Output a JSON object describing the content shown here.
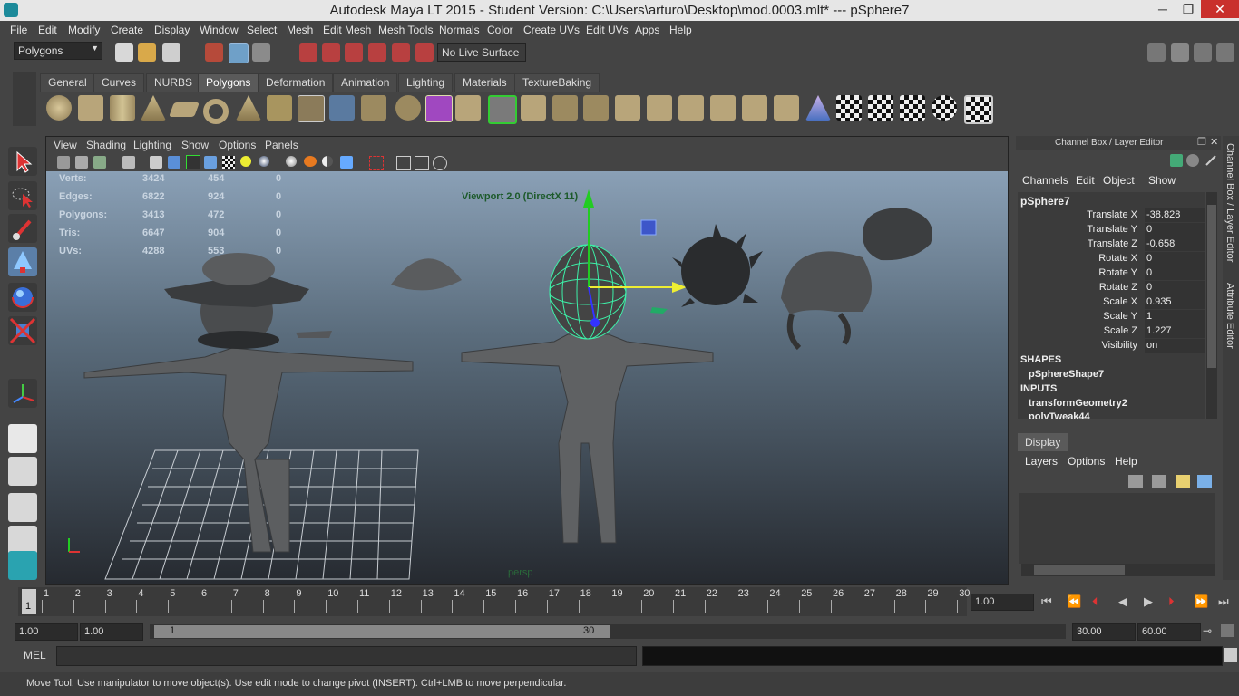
{
  "window": {
    "title": "Autodesk Maya LT 2015 - Student Version: C:\\Users\\arturo\\Desktop\\mod.0003.mlt*   ---   pSphere7",
    "minimize": "─",
    "maximize": "❐",
    "close": "✕"
  },
  "menu": [
    "File",
    "Edit",
    "Modify",
    "Create",
    "Display",
    "Window",
    "Select",
    "Mesh",
    "Edit Mesh",
    "Mesh Tools",
    "Normals",
    "Color",
    "Create UVs",
    "Edit UVs",
    "Apps",
    "Help"
  ],
  "statusline": {
    "mode": "Polygons",
    "live_surface": "No Live Surface"
  },
  "shelf": {
    "tabs": [
      "General",
      "Curves",
      "NURBS",
      "Polygons",
      "Deformation",
      "Animation",
      "Lighting",
      "Materials",
      "TextureBaking"
    ],
    "active_tab": "Polygons"
  },
  "viewport": {
    "menu": [
      "View",
      "Shading",
      "Lighting",
      "Show",
      "Options",
      "Panels"
    ],
    "renderer_label": "Viewport 2.0 (DirectX 11)",
    "camera_label": "persp",
    "hud": [
      {
        "label": "Verts:",
        "a": "3424",
        "b": "454",
        "c": "0"
      },
      {
        "label": "Edges:",
        "a": "6822",
        "b": "924",
        "c": "0"
      },
      {
        "label": "Polygons:",
        "a": "3413",
        "b": "472",
        "c": "0"
      },
      {
        "label": "Tris:",
        "a": "6647",
        "b": "904",
        "c": "0"
      },
      {
        "label": "UVs:",
        "a": "4288",
        "b": "553",
        "c": "0"
      }
    ]
  },
  "channel_box": {
    "header": "Channel Box / Layer Editor",
    "menu": [
      "Channels",
      "Edit",
      "Object",
      "Show"
    ],
    "object": "pSphere7",
    "attributes": [
      {
        "name": "Translate X",
        "value": "-38.828"
      },
      {
        "name": "Translate Y",
        "value": "0"
      },
      {
        "name": "Translate Z",
        "value": "-0.658"
      },
      {
        "name": "Rotate X",
        "value": "0"
      },
      {
        "name": "Rotate Y",
        "value": "0"
      },
      {
        "name": "Rotate Z",
        "value": "0"
      },
      {
        "name": "Scale X",
        "value": "0.935"
      },
      {
        "name": "Scale Y",
        "value": "1"
      },
      {
        "name": "Scale Z",
        "value": "1.227"
      },
      {
        "name": "Visibility",
        "value": "on"
      }
    ],
    "shapes_header": "SHAPES",
    "shape": "pSphereShape7",
    "inputs_header": "INPUTS",
    "inputs": [
      "transformGeometry2",
      "polyTweak44"
    ]
  },
  "side_tabs": [
    "Channel Box / Layer Editor",
    "Attribute Editor"
  ],
  "layer_editor": {
    "tab": "Display",
    "menu": [
      "Layers",
      "Options",
      "Help"
    ]
  },
  "timeline": {
    "ticks": [
      "1",
      "2",
      "3",
      "4",
      "5",
      "6",
      "7",
      "8",
      "9",
      "10",
      "11",
      "12",
      "13",
      "14",
      "15",
      "16",
      "17",
      "18",
      "19",
      "20",
      "21",
      "22",
      "23",
      "24",
      "25",
      "26",
      "27",
      "28",
      "29",
      "30"
    ],
    "current_frame": "1",
    "current_time_field": "1.00"
  },
  "range": {
    "start": "1.00",
    "anim_start": "1.00",
    "slider_start": "1",
    "slider_end": "30",
    "playback_end": "30.00",
    "anim_end": "60.00"
  },
  "command": {
    "language": "MEL"
  },
  "help_line": "Move Tool: Use manipulator to move object(s). Use edit mode to change pivot (INSERT).  Ctrl+LMB to move perpendicular."
}
